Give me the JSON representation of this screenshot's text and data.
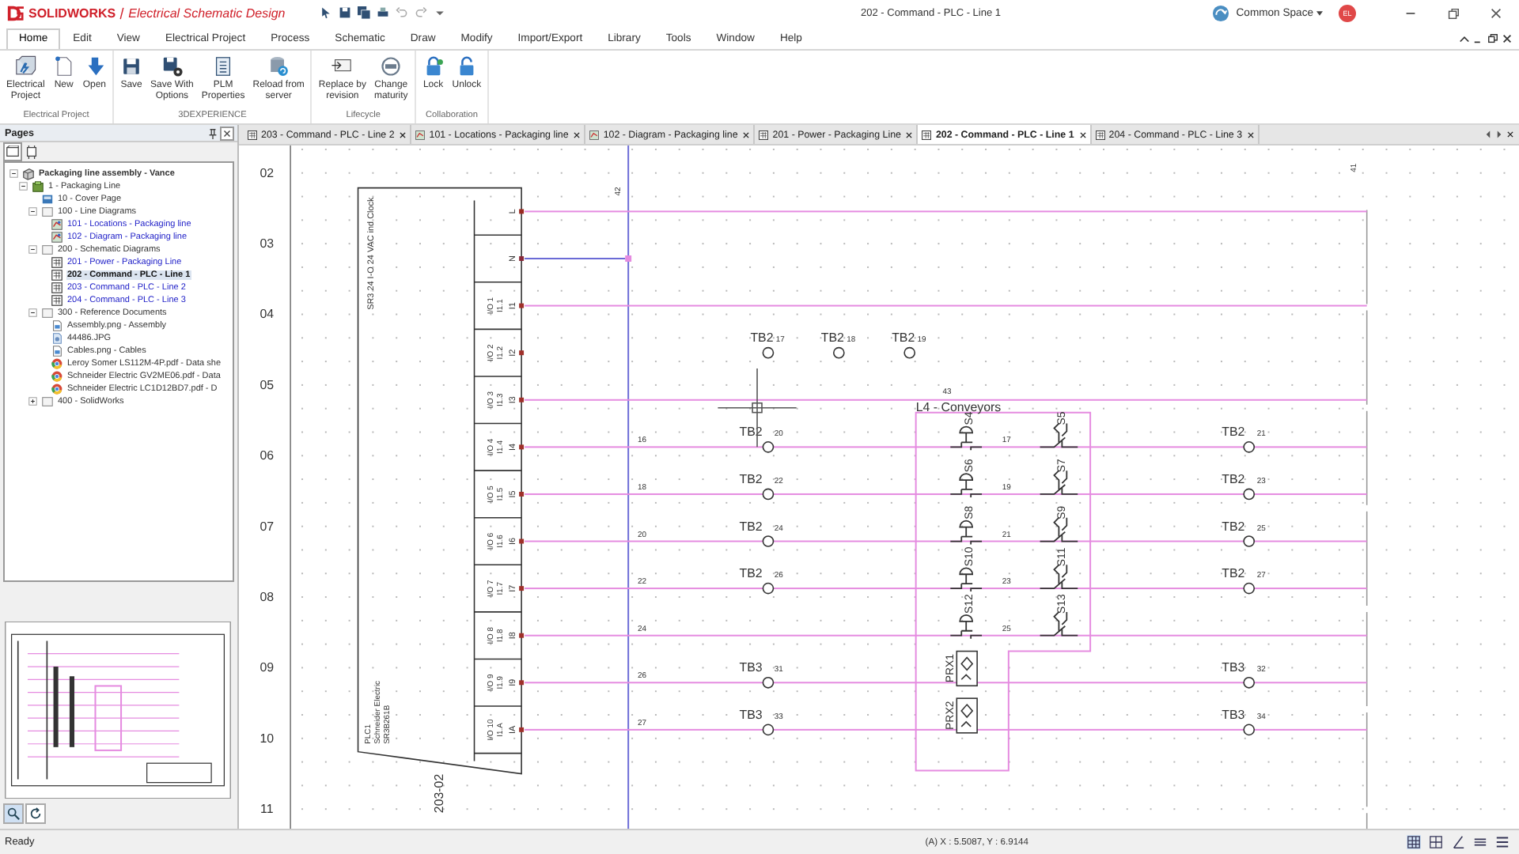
{
  "title_bar": {
    "brand": "SOLIDWORKS",
    "product": "Electrical Schematic Design",
    "document": "202 - Command - PLC - Line 1",
    "workspace": "Common Space",
    "user_initials": "EL"
  },
  "menu_tabs": [
    {
      "label": "Home",
      "selected": true
    },
    {
      "label": "Edit",
      "selected": false
    },
    {
      "label": "View",
      "selected": false
    },
    {
      "label": "Electrical Project",
      "selected": false
    },
    {
      "label": "Process",
      "selected": false
    },
    {
      "label": "Schematic",
      "selected": false
    },
    {
      "label": "Draw",
      "selected": false
    },
    {
      "label": "Modify",
      "selected": false
    },
    {
      "label": "Import/Export",
      "selected": false
    },
    {
      "label": "Library",
      "selected": false
    },
    {
      "label": "Tools",
      "selected": false
    },
    {
      "label": "Window",
      "selected": false
    },
    {
      "label": "Help",
      "selected": false
    }
  ],
  "ribbon": {
    "groups": [
      {
        "label": "Electrical Project",
        "buttons": [
          {
            "label": "Electrical\nProject",
            "kind": "project"
          },
          {
            "label": "New",
            "kind": "new"
          },
          {
            "label": "Open",
            "kind": "open"
          }
        ]
      },
      {
        "label": "3DEXPERIENCE",
        "buttons": [
          {
            "label": "Save",
            "kind": "save"
          },
          {
            "label": "Save With\nOptions",
            "kind": "save_options"
          },
          {
            "label": "PLM\nProperties",
            "kind": "plm"
          },
          {
            "label": "Reload from\nserver",
            "kind": "reload"
          }
        ]
      },
      {
        "label": "Lifecycle",
        "buttons": [
          {
            "label": "Replace by\nrevision",
            "kind": "replace"
          },
          {
            "label": "Change\nmaturity",
            "kind": "maturity"
          }
        ]
      },
      {
        "label": "Collaboration",
        "buttons": [
          {
            "label": "Lock",
            "kind": "lock"
          },
          {
            "label": "Unlock",
            "kind": "unlock"
          }
        ]
      }
    ]
  },
  "pages_panel": {
    "title": "Pages",
    "tree": [
      {
        "label": "Packaging line assembly - Vance",
        "kind": "project",
        "expanded": true,
        "selected": false,
        "children": [
          {
            "label": "1 - Packaging Line",
            "kind": "book",
            "expanded": true,
            "selected": false,
            "children": [
              {
                "label": "10 - Cover Page",
                "kind": "cover",
                "selected": false
              },
              {
                "label": "100 - Line Diagrams",
                "kind": "folder",
                "expanded": true,
                "selected": false,
                "children": [
                  {
                    "label": "101 - Locations - Packaging line",
                    "kind": "line_diagram",
                    "selected": false
                  },
                  {
                    "label": "102 - Diagram - Packaging line",
                    "kind": "line_diagram",
                    "selected": false
                  }
                ]
              },
              {
                "label": "200 - Schematic Diagrams",
                "kind": "folder",
                "expanded": true,
                "selected": false,
                "children": [
                  {
                    "label": "201 - Power - Packaging Line",
                    "kind": "schematic",
                    "selected": false
                  },
                  {
                    "label": "202 - Command - PLC - Line 1",
                    "kind": "schematic",
                    "selected": true
                  },
                  {
                    "label": "203 - Command - PLC - Line 2",
                    "kind": "schematic",
                    "selected": false
                  },
                  {
                    "label": "204 - Command - PLC - Line 3",
                    "kind": "schematic",
                    "selected": false
                  }
                ]
              },
              {
                "label": "300 - Reference Documents",
                "kind": "folder",
                "expanded": true,
                "selected": false,
                "children": [
                  {
                    "label": "Assembly.png - Assembly",
                    "kind": "image",
                    "selected": false
                  },
                  {
                    "label": "44486.JPG",
                    "kind": "photo",
                    "selected": false
                  },
                  {
                    "label": "Cables.png - Cables",
                    "kind": "image",
                    "selected": false
                  },
                  {
                    "label": "Leroy Somer LS112M-4P.pdf - Data she",
                    "kind": "pdf",
                    "selected": false
                  },
                  {
                    "label": "Schneider Electric GV2ME06.pdf - Data",
                    "kind": "pdf",
                    "selected": false
                  },
                  {
                    "label": "Schneider Electric LC1D12BD7.pdf - D",
                    "kind": "pdf",
                    "selected": false
                  }
                ]
              },
              {
                "label": "400 - SolidWorks",
                "kind": "folder",
                "expanded": false,
                "selected": false
              }
            ]
          }
        ]
      }
    ]
  },
  "document_tabs": [
    {
      "label": "203 - Command - PLC - Line 2",
      "kind": "schematic",
      "selected": false
    },
    {
      "label": "101 - Locations - Packaging line",
      "kind": "line_diagram",
      "selected": false
    },
    {
      "label": "102 - Diagram - Packaging line",
      "kind": "line_diagram",
      "selected": false
    },
    {
      "label": "201 - Power - Packaging Line",
      "kind": "schematic",
      "selected": false
    },
    {
      "label": "202 - Command - PLC - Line 1",
      "kind": "schematic",
      "selected": true
    },
    {
      "label": "204 - Command - PLC - Line 3",
      "kind": "schematic",
      "selected": false
    }
  ],
  "schematic": {
    "row_numbers": [
      "02",
      "03",
      "04",
      "05",
      "06",
      "07",
      "08",
      "09",
      "10",
      "11"
    ],
    "plc": {
      "description": "SR3 24 I-O 24 VAC ind Clock",
      "tag": "PLC1",
      "maker": "Schneider Electric",
      "reference": "SR3B261B",
      "sheet_ref": "203-02"
    },
    "annotations": [
      {
        "text": "42",
        "kind": "bus"
      },
      {
        "text": "43",
        "kind": "box"
      },
      {
        "text": "41",
        "kind": "edge"
      }
    ],
    "box_title": "L4 - Conveyors",
    "rows": [
      {
        "pin": "L",
        "kind": "supply",
        "connected": true
      },
      {
        "pin": "N",
        "kind": "neutral",
        "connected": true
      },
      {
        "pin": "I1",
        "io": "I/O 1",
        "address": "I1.1",
        "kind": "input",
        "connected": true
      },
      {
        "pin": "I2",
        "io": "I/O 2",
        "address": "I1.2",
        "kind": "input",
        "connected": false,
        "free_blocks": [
          {
            "tag": "TB2",
            "number": "17"
          },
          {
            "tag": "TB2",
            "number": "18"
          },
          {
            "tag": "TB2",
            "number": "19"
          }
        ]
      },
      {
        "pin": "I3",
        "io": "I/O 3",
        "address": "I1.3",
        "kind": "input",
        "connected": true
      },
      {
        "pin": "I4",
        "io": "I/O 4",
        "address": "I1.4",
        "kind": "input",
        "connected": true,
        "wire": "16",
        "left_block": {
          "tag": "TB2",
          "number": "20"
        },
        "devices": [
          {
            "tag": "S4",
            "kind": "pushbutton_no"
          },
          {
            "tag": "S5",
            "kind": "pushbutton_nc"
          }
        ],
        "link_wire": "17",
        "right_block": {
          "tag": "TB2",
          "number": "21"
        }
      },
      {
        "pin": "I5",
        "io": "I/O 5",
        "address": "I1.5",
        "kind": "input",
        "connected": true,
        "wire": "18",
        "left_block": {
          "tag": "TB2",
          "number": "22"
        },
        "devices": [
          {
            "tag": "S6",
            "kind": "pushbutton_no"
          },
          {
            "tag": "S7",
            "kind": "pushbutton_nc"
          }
        ],
        "link_wire": "19",
        "right_block": {
          "tag": "TB2",
          "number": "23"
        }
      },
      {
        "pin": "I6",
        "io": "I/O 6",
        "address": "I1.6",
        "kind": "input",
        "connected": true,
        "wire": "20",
        "left_block": {
          "tag": "TB2",
          "number": "24"
        },
        "devices": [
          {
            "tag": "S8",
            "kind": "pushbutton_no"
          },
          {
            "tag": "S9",
            "kind": "pushbutton_nc"
          }
        ],
        "link_wire": "21",
        "right_block": {
          "tag": "TB2",
          "number": "25"
        }
      },
      {
        "pin": "I7",
        "io": "I/O 7",
        "address": "I1.7",
        "kind": "input",
        "connected": true,
        "wire": "22",
        "left_block": {
          "tag": "TB2",
          "number": "26"
        },
        "devices": [
          {
            "tag": "S10",
            "kind": "pushbutton_no"
          },
          {
            "tag": "S11",
            "kind": "pushbutton_nc"
          }
        ],
        "link_wire": "23",
        "right_block": {
          "tag": "TB2",
          "number": "27"
        }
      },
      {
        "pin": "I8",
        "io": "I/O 8",
        "address": "I1.8",
        "kind": "input",
        "connected": true,
        "wire": "24",
        "devices": [
          {
            "tag": "S12",
            "kind": "pushbutton_no"
          },
          {
            "tag": "S13",
            "kind": "pushbutton_nc"
          }
        ],
        "link_wire": "25"
      },
      {
        "pin": "I9",
        "io": "I/O 9",
        "address": "I1.9",
        "kind": "input",
        "connected": true,
        "wire": "26",
        "left_block": {
          "tag": "TB3",
          "number": "31"
        },
        "devices": [
          {
            "tag": "PRX1",
            "kind": "proximity"
          }
        ],
        "right_block": {
          "tag": "TB3",
          "number": "32"
        }
      },
      {
        "pin": "IA",
        "io": "I/O 10",
        "address": "I1.A",
        "kind": "input",
        "connected": true,
        "wire": "27",
        "left_block": {
          "tag": "TB3",
          "number": "33"
        },
        "devices": [
          {
            "tag": "PRX2",
            "kind": "proximity"
          }
        ],
        "right_block": {
          "tag": "TB3",
          "number": "34"
        }
      }
    ]
  },
  "status_bar": {
    "message": "Ready",
    "coordinates": "(A) X : 5.5087, Y : 6.9144"
  }
}
